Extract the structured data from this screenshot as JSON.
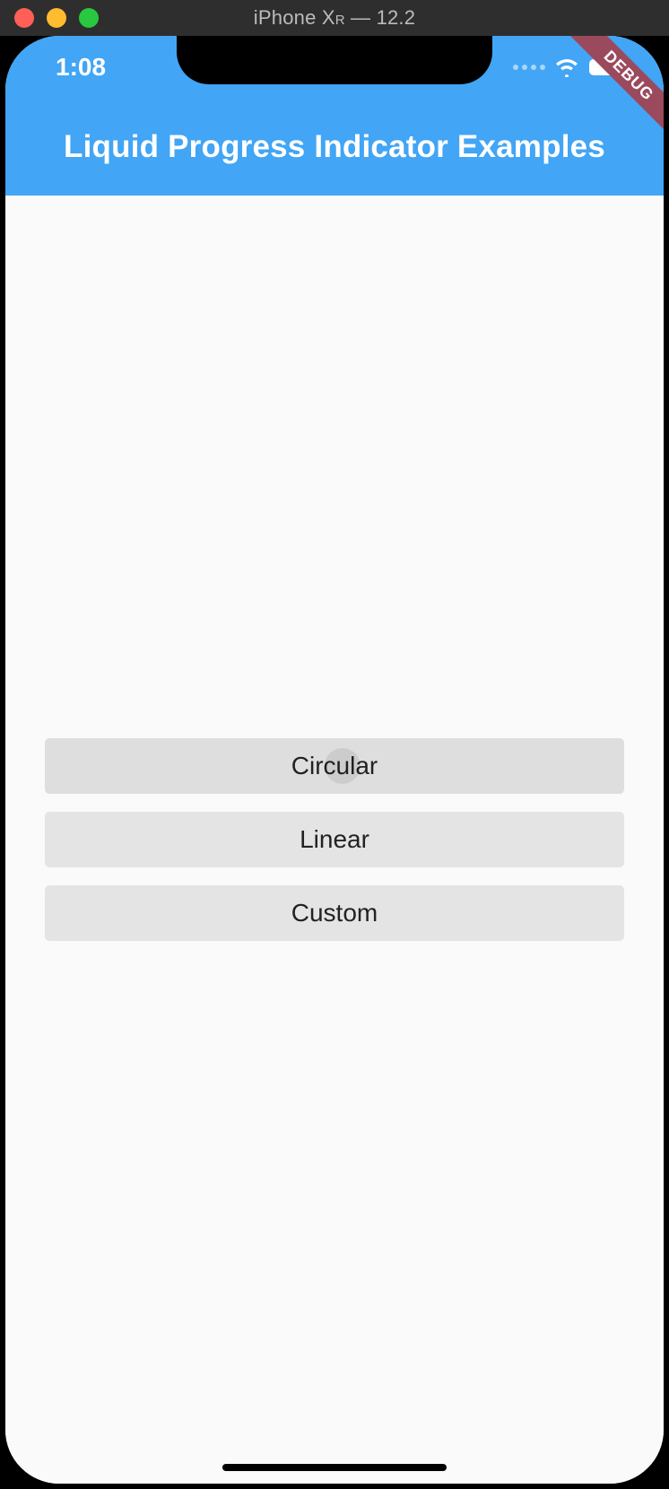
{
  "simulator": {
    "title_prefix": "iPhone X",
    "title_small": "R",
    "title_suffix": " — 12.2"
  },
  "status": {
    "time": "1:08"
  },
  "debug_banner": "DEBUG",
  "appbar": {
    "title": "Liquid Progress Indicator Examples"
  },
  "buttons": [
    {
      "label": "Circular"
    },
    {
      "label": "Linear"
    },
    {
      "label": "Custom"
    }
  ],
  "colors": {
    "appbar": "#42a5f5",
    "body_bg": "#fafafa",
    "button_bg": "#e4e4e4"
  }
}
